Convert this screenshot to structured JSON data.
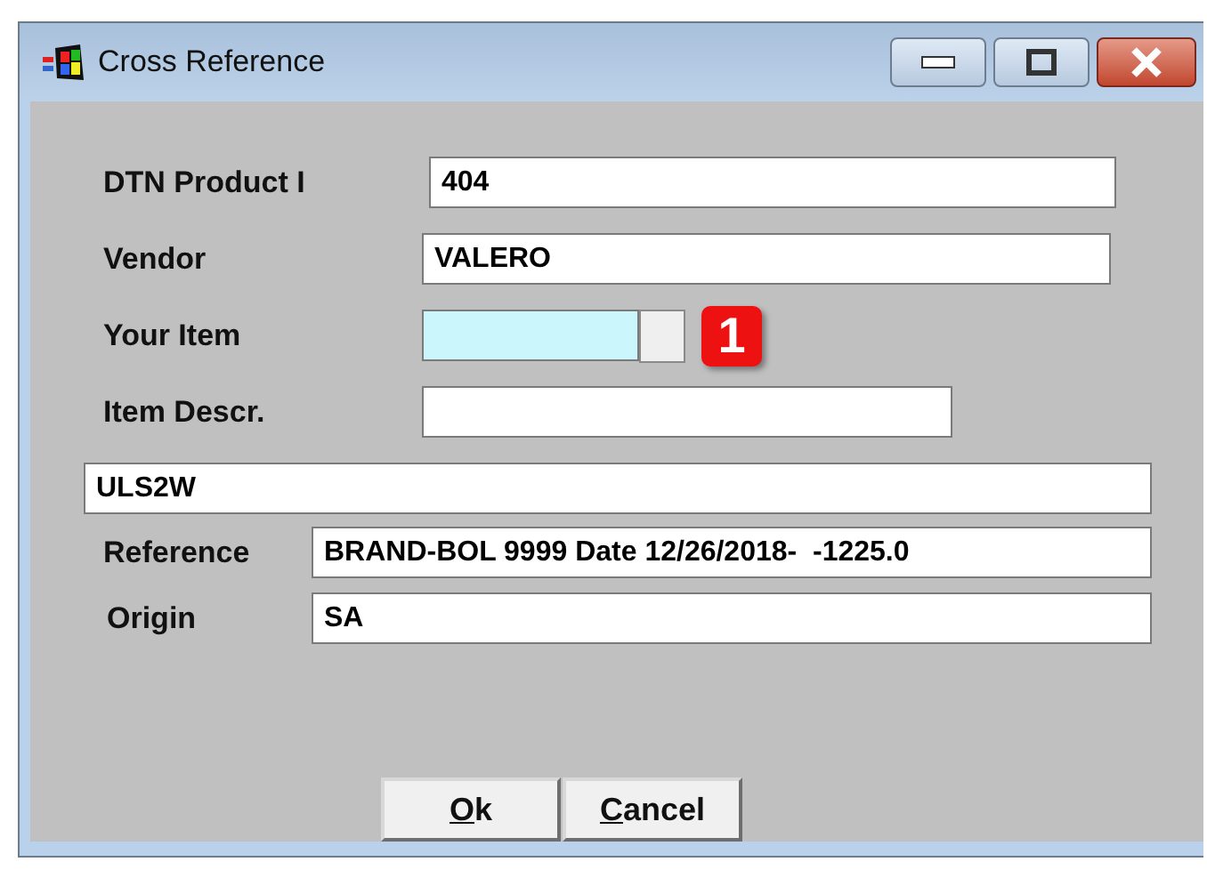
{
  "window": {
    "title": "Cross Reference"
  },
  "fields": [
    {
      "kind": "labeled",
      "label": "DTN Product I",
      "value": "404"
    },
    {
      "kind": "labeled",
      "label": "Vendor",
      "value": "VALERO"
    },
    {
      "kind": "lookup",
      "label": "Your Item",
      "badge": "1"
    },
    {
      "kind": "labeled",
      "label": "Item Descr."
    },
    {
      "kind": "full",
      "value": "ULS2W"
    },
    {
      "kind": "compact",
      "label": "Reference",
      "value": "BRAND-BOL 9999 Date 12/26/2018-  -1225.0"
    },
    {
      "kind": "compact",
      "label": "Origin",
      "value": "SA"
    }
  ],
  "buttons": [
    {
      "label": "Ok",
      "mnemonic_underlined": true
    },
    {
      "label": "Cancel",
      "mnemonic_underlined": true
    }
  ]
}
